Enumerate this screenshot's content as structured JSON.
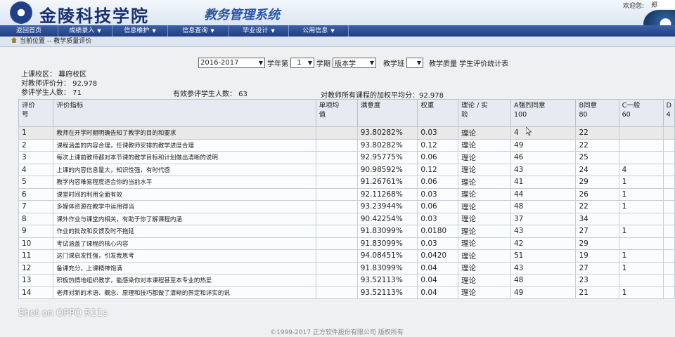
{
  "header": {
    "school_name": "金陵科技学院",
    "system_name": "教务管理系统",
    "welcome": "欢迎您:",
    "user": "郑"
  },
  "nav": {
    "items": [
      {
        "label": "返回首页",
        "has_menu": false
      },
      {
        "label": "成绩录入",
        "has_menu": true
      },
      {
        "label": "信息维护",
        "has_menu": true
      },
      {
        "label": "信息查询",
        "has_menu": true
      },
      {
        "label": "毕业设计",
        "has_menu": true
      },
      {
        "label": "公用信息",
        "has_menu": true
      }
    ]
  },
  "breadcrumb": "当前位置 -- 教学质量评价",
  "filters": {
    "year": "2016-2017",
    "year_suffix": "学年第",
    "term": "1",
    "term_suffix": "学期",
    "course_type": "版本学",
    "class_label": "教学班",
    "class_value": "",
    "report_title": "教学质量 学生评价统计表"
  },
  "info": {
    "campus": "上课校区：   幕府校区",
    "teacher_score": "对教师评价分：  92.978",
    "participants": "参评学生人数：  71",
    "valid_participants": "有效参评学生人数：  63",
    "weighted_avg": "对教师所有课程的加权平均分：92.978"
  },
  "table": {
    "headers": [
      "评价\n号",
      "评价指标",
      "单项均\n值",
      "满意度",
      "权重",
      "理论 / 实\n验",
      "A强烈同意\n100",
      "B同意\n80",
      "C一般\n60",
      "D\n4"
    ],
    "rows": [
      [
        "1",
        "教师在开学时期明确告知了教学的目的和要求",
        "",
        "93.80282%",
        "0.03",
        "理论",
        "4",
        "22",
        "",
        ""
      ],
      [
        "2",
        "课程涵盖的内容合理，任课教师安排的教学进度合理",
        "",
        "93.80282%",
        "0.12",
        "理论",
        "49",
        "22",
        "",
        ""
      ],
      [
        "3",
        "每次上课前教师都对本节课的教学目标和计划做出清晰的说明",
        "",
        "92.95775%",
        "0.06",
        "理论",
        "46",
        "25",
        "",
        ""
      ],
      [
        "4",
        "上课的内容信息量大，知识性强，有时代感",
        "",
        "90.98592%",
        "0.12",
        "理论",
        "43",
        "24",
        "4",
        ""
      ],
      [
        "5",
        "教学内容难易程度适合你的当前水平",
        "",
        "91.26761%",
        "0.06",
        "理论",
        "41",
        "29",
        "1",
        ""
      ],
      [
        "6",
        "课堂时间的利用全面有效",
        "",
        "92.11268%",
        "0.03",
        "理论",
        "44",
        "26",
        "1",
        ""
      ],
      [
        "7",
        "多媒体资源在教学中运用得当",
        "",
        "93.23944%",
        "0.06",
        "理论",
        "48",
        "22",
        "1",
        ""
      ],
      [
        "8",
        "课外作业与课堂内相关，有助于你了解课程内涵",
        "",
        "90.42254%",
        "0.03",
        "理论",
        "37",
        "34",
        "",
        ""
      ],
      [
        "9",
        "作业的批改和反馈及时不拖延",
        "",
        "91.83099%",
        "0.0180",
        "理论",
        "43",
        "27",
        "1",
        ""
      ],
      [
        "10",
        "考试涵盖了课程的核心内容",
        "",
        "91.83099%",
        "0.03",
        "理论",
        "42",
        "29",
        "",
        ""
      ],
      [
        "11",
        "这门课启发性强，引发我思考",
        "",
        "94.08451%",
        "0.0420",
        "理论",
        "51",
        "19",
        "1",
        ""
      ],
      [
        "12",
        "备课充分，上课精神饱满",
        "",
        "91.83099%",
        "0.04",
        "理论",
        "43",
        "27",
        "1",
        ""
      ],
      [
        "13",
        "积极热情地组织教学，能感染你对本课程甚至本专业的热爱",
        "",
        "93.52113%",
        "0.04",
        "理论",
        "48",
        "23",
        "",
        ""
      ],
      [
        "14",
        "老师对新的术语、概念、原理和技巧都做了清晰的界定和详实的说",
        "",
        "93.52113%",
        "0.04",
        "理论",
        "49",
        "21",
        "1",
        ""
      ]
    ]
  },
  "footer": "©1999-2017  正方软件股份有限公司  版权所有",
  "watermark": "Shot on OPPO R11s"
}
